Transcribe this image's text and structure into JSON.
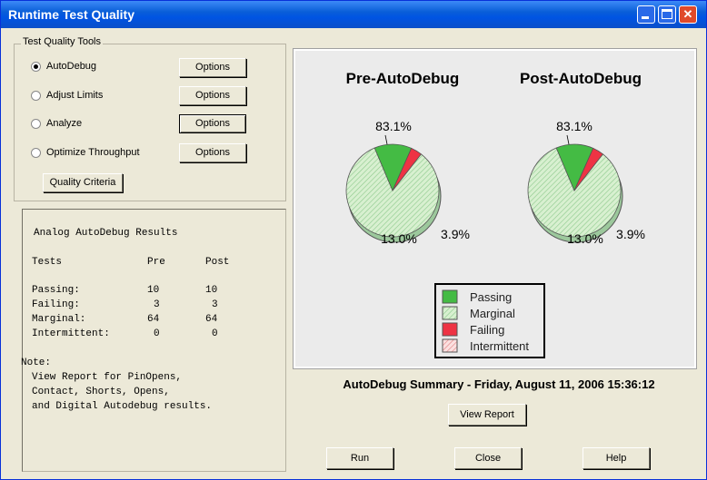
{
  "window": {
    "title": "Runtime Test Quality"
  },
  "tools": {
    "legend": "Test Quality Tools",
    "options": [
      {
        "label": "AutoDebug",
        "selected": true
      },
      {
        "label": "Adjust Limits",
        "selected": false
      },
      {
        "label": "Analyze",
        "selected": false
      },
      {
        "label": "Optimize Throughput",
        "selected": false
      }
    ],
    "options_button": "Options",
    "quality_criteria_button": "Quality Criteria"
  },
  "results": {
    "heading": "Analog AutoDebug Results",
    "columns": [
      "Tests",
      "Pre",
      "Post"
    ],
    "rows": [
      {
        "name": "Passing:",
        "pre": "10",
        "post": "10"
      },
      {
        "name": "Failing:",
        "pre": "3",
        "post": "3"
      },
      {
        "name": "Marginal:",
        "pre": "64",
        "post": "64"
      },
      {
        "name": "Intermittent:",
        "pre": "0",
        "post": "0"
      }
    ],
    "note_label": "Note:",
    "note_lines": [
      "View Report for PinOpens,",
      "Contact, Shorts, Opens,",
      "and Digital Autodebug results."
    ]
  },
  "chart_data": {
    "type": "pie",
    "charts": [
      {
        "title": "Pre-AutoDebug",
        "labels": [
          "83.1%",
          "13.0%",
          "3.9%"
        ]
      },
      {
        "title": "Post-AutoDebug",
        "labels": [
          "83.1%",
          "13.0%",
          "3.9%"
        ]
      }
    ],
    "slices": [
      {
        "name": "Marginal",
        "value": 83.1,
        "color": "#c8e8c0"
      },
      {
        "name": "Passing",
        "value": 13.0,
        "color": "#44bb44"
      },
      {
        "name": "Failing",
        "value": 3.9,
        "color": "#ee3344"
      },
      {
        "name": "Intermittent",
        "value": 0,
        "color": "#f4c0c0"
      }
    ],
    "legend": [
      {
        "name": "Passing",
        "color": "#44bb44"
      },
      {
        "name": "Marginal",
        "color": "#c8e8c0"
      },
      {
        "name": "Failing",
        "color": "#ee3344"
      },
      {
        "name": "Intermittent",
        "color": "#f4c0c0"
      }
    ]
  },
  "summary": "AutoDebug Summary - Friday, August 11, 2006 15:36:12",
  "buttons": {
    "view_report": "View Report",
    "run": "Run",
    "close": "Close",
    "help": "Help"
  }
}
